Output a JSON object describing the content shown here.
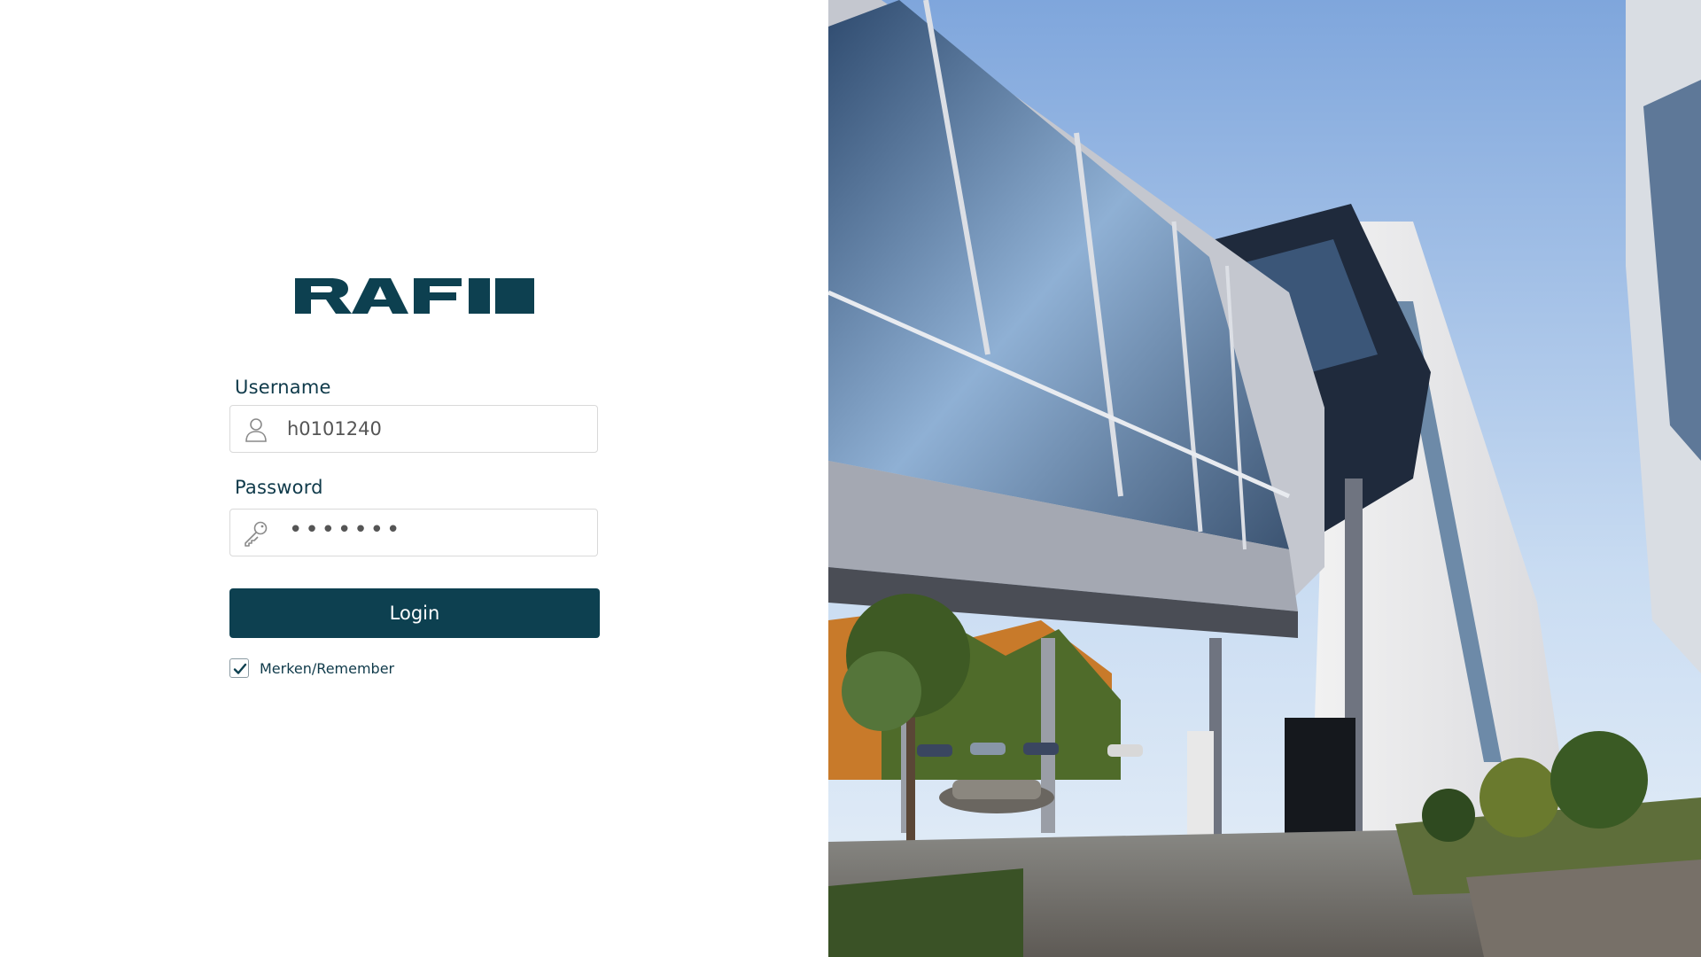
{
  "brand": {
    "logo_text": "RAFI",
    "logo_color": "#0d4050"
  },
  "login": {
    "username_label": "Username",
    "username_value": "h0101240",
    "username_icon": "user-icon",
    "password_label": "Password",
    "password_masked": "•••••••",
    "password_icon": "key-icon",
    "login_button_label": "Login",
    "remember_label": "Merken/Remember",
    "remember_checked": true
  },
  "colors": {
    "accent": "#0d4050",
    "label_text": "#0f3a4a",
    "input_border": "#d9d9d9"
  },
  "background_image": {
    "subject": "building-photo"
  }
}
